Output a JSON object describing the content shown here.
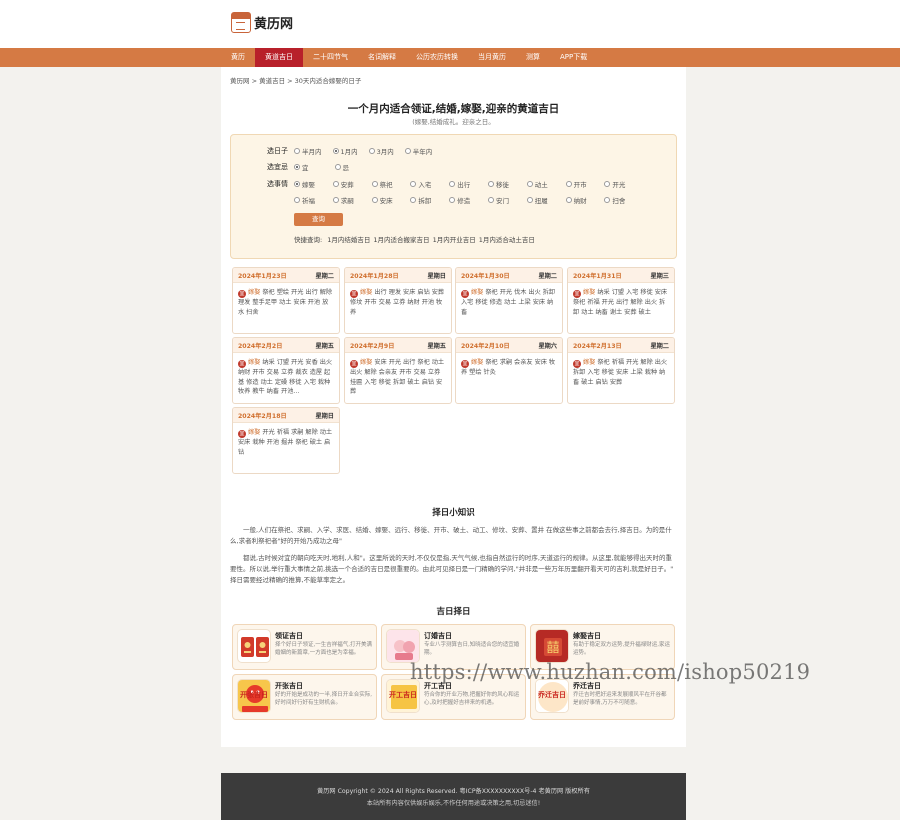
{
  "site": {
    "logo_text": "黄历网",
    "logo_icon": "calendar-icon"
  },
  "nav": {
    "items": [
      "黄历",
      "黄道吉日",
      "二十四节气",
      "名词解释",
      "公历农历转换",
      "当月黄历",
      "测算",
      "APP下载"
    ],
    "active_index": 1
  },
  "breadcrumb": "黄历网 > 黄道吉日 > 30天内适合嫁娶的日子",
  "page": {
    "title": "一个月内适合领证,结婚,嫁娶,迎亲的黄道吉日",
    "subtitle": "(嫁娶,结婚成礼。迎亲之日。"
  },
  "filter": {
    "period": {
      "label": "选日子",
      "options": [
        "半月内",
        "1月内",
        "3月内",
        "半年内"
      ],
      "selected": 1
    },
    "yiji": {
      "label": "选宜忌",
      "options": [
        "宜",
        "忌"
      ],
      "selected": 0
    },
    "events": {
      "label": "选事情",
      "options": [
        "嫁娶",
        "安葬",
        "祭祀",
        "入宅",
        "出行",
        "移徙",
        "动土",
        "开市",
        "开光",
        "祈福",
        "求嗣",
        "安床",
        "拆卸",
        "修造",
        "安门",
        "扭履",
        "纳财",
        "扫舍"
      ],
      "selected": 0
    },
    "query_button": "查询",
    "quick": {
      "label": "快捷查询:",
      "links": [
        "1月内结婚吉日",
        "1月内适合搬家吉日",
        "1月内开业吉日",
        "1月内适合动土吉日"
      ]
    }
  },
  "days": [
    {
      "date": "2024年1月23日",
      "week": "星期二",
      "badge": "宜",
      "keyword": "嫁娶",
      "text": "祭祀 塑绘 开光 出行 解除 理发 整手足甲 动土 安床 开池 放水 扫舍"
    },
    {
      "date": "2024年1月28日",
      "week": "星期日",
      "badge": "宜",
      "keyword": "嫁娶",
      "text": "出行 理发 安床 启钻 安葬 修坟 开市 交易 立券 纳财 开池 牧养"
    },
    {
      "date": "2024年1月30日",
      "week": "星期二",
      "badge": "宜",
      "keyword": "嫁娶",
      "text": "祭祀 开光 伐木 出火 拆卸 入宅 移徙 修造 动土 上梁 安床 纳畜"
    },
    {
      "date": "2024年1月31日",
      "week": "星期三",
      "badge": "宜",
      "keyword": "嫁娶",
      "text": "纳采 订盟 入宅 移徙 安床 祭祀 祈福 开光 出行 解除 出火 拆卸 动土 纳畜 谢土 安葬 破土"
    },
    {
      "date": "2024年2月2日",
      "week": "星期五",
      "badge": "宜",
      "keyword": "嫁娶",
      "text": "纳采 订盟 开光 安香 出火 纳财 开市 交易 立券 裁衣 造屋 起基 修造 动土 定磉 移徙 入宅 栽种 牧养 教牛 纳畜 开池..."
    },
    {
      "date": "2024年2月9日",
      "week": "星期五",
      "badge": "宜",
      "keyword": "嫁娶",
      "text": "安床 开光 出行 祭祀 动土 出火 解除 会亲友 开市 交易 立券 挂匾 入宅 移徙 拆卸 破土 启钻 安葬"
    },
    {
      "date": "2024年2月10日",
      "week": "星期六",
      "badge": "宜",
      "keyword": "嫁娶",
      "text": "祭祀 求嗣 会亲友 安床 牧养 塑绘 针灸"
    },
    {
      "date": "2024年2月13日",
      "week": "星期二",
      "badge": "宜",
      "keyword": "嫁娶",
      "text": "祭祀 祈福 开光 解除 出火 拆卸 入宅 移徙 安床 上梁 栽种 纳畜 破土 启钻 安葬"
    },
    {
      "date": "2024年2月18日",
      "week": "星期日",
      "badge": "宜",
      "keyword": "嫁娶",
      "text": "开光 祈福 求嗣 解除 动土 安床 栽种 开池 掘井 祭祀 破土 启钻"
    }
  ],
  "knowledge": {
    "title": "择日小知识",
    "paragraphs": [
      "一般,人们在祭祀、求嗣、入学、求医、结婚、嫁娶、远行、移徙、开市、破土、动工、修坟、安葬、置井 在做这些事之前都会去行,择吉日。为的是什么,求者利祭祀者\"好的开始乃成功之母\"",
      "都说,古时候对宜的朝向吃天时,地利,人和\"。这里所说的天时,不仅仅是指,天气气候,也指自然运行的时序,天道运行的规律。从这里,就能够得出天时的重要性。所以说,举行重大事情之前,挑选一个合适的吉日是很重要的。由此可见择日是一门精确的学问,\"并非是一些万年历里翻开看天可的吉利,就是好日子。\" 择日需要经过精确的推算,不能草率定之。"
    ]
  },
  "tools": {
    "title": "吉日择日",
    "items": [
      {
        "name": "领证吉日",
        "desc": "择个好日子领证,一生吉祥福气,打开美满婚姻的新篇章,一方面也是为幸福。",
        "icon": "marriage-certificate-icon",
        "label": ""
      },
      {
        "name": "订婚吉日",
        "desc": "专业八字测算吉日,知晓适合您的适宜婚期。",
        "icon": "engagement-icon",
        "label": ""
      },
      {
        "name": "嫁娶吉日",
        "desc": "有助于稳定双方运势,提升福禄财运,家运运势。",
        "icon": "wedding-icon",
        "label": ""
      },
      {
        "name": "开张吉日",
        "desc": "好的开始是成功的一半,择日开业合实际,好时间好行好有生财机会。",
        "icon": "opening-icon",
        "label": "开张吉日"
      },
      {
        "name": "开工吉日",
        "desc": "符合你的开业万物,把握好你的风心和运心,及时把握好吉祥来的机遇。",
        "icon": "start-work-icon",
        "label": "开工吉日"
      },
      {
        "name": "乔迁吉日",
        "desc": "乔迁吉时把好运来发展顺风平在开谷都是前好事情,万万不可随意。",
        "icon": "move-house-icon",
        "label": "乔迁吉日"
      }
    ]
  },
  "watermark": "https://www.huzhan.com/ishop50219",
  "footer": {
    "line1": "黄历网   Copyright © 2024 All Rights Reserved.   粤ICP备XXXXXXXXXX号-4   老黄历网   版权所有",
    "line2": "本站所有内容仅供娱乐娱乐,不作任何用途或决策之用,切忌迷信!"
  },
  "colors": {
    "accent": "#d57a44",
    "active_nav": "#b8202a",
    "red_badge": "#c0382b"
  }
}
